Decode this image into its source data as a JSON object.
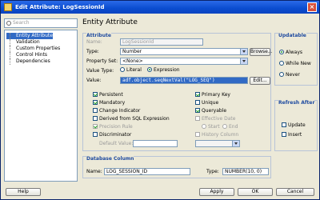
{
  "window": {
    "title": "Edit Attribute: LogSessionId",
    "close_glyph": "×"
  },
  "search": {
    "placeholder": "Search"
  },
  "nav": {
    "items": [
      {
        "label": "Entity Attribute",
        "selected": true
      },
      {
        "label": "Validation"
      },
      {
        "label": "Custom Properties"
      },
      {
        "label": "Control Hints"
      },
      {
        "label": "Dependencies"
      }
    ]
  },
  "panel": {
    "title": "Entity Attribute"
  },
  "attribute": {
    "legend": "Attribute",
    "name_label": "Name:",
    "name_value": "LogSessionId",
    "type_label": "Type:",
    "type_value": "Number",
    "browse_label": "Browse...",
    "property_set_label": "Property Set:",
    "property_set_value": "<None>",
    "value_type_label": "Value Type:",
    "value_type_literal": "Literal",
    "value_type_expression": "Expression",
    "value_label": "Value:",
    "value_value": "adf.object.seqNextVal(\"LOG_SEQ\")",
    "edit_label": "Edit...",
    "checkboxes_left": [
      {
        "label": "Persistent",
        "checked": true
      },
      {
        "label": "Mandatory",
        "checked": true
      },
      {
        "label": "Change Indicator",
        "checked": false
      },
      {
        "label": "Derived from SQL Expression",
        "checked": false
      },
      {
        "label": "Precision Rule",
        "checked": true,
        "disabled": true
      },
      {
        "label": "Discriminator",
        "checked": false
      }
    ],
    "default_value_label": "Default Value:",
    "checkboxes_right": [
      {
        "label": "Primary Key",
        "checked": true
      },
      {
        "label": "Unique",
        "checked": false
      },
      {
        "label": "Queryable",
        "checked": true
      },
      {
        "label": "Effective Date",
        "checked": false,
        "disabled": true
      },
      {
        "label": "History Column",
        "checked": false,
        "disabled": true
      }
    ],
    "start_label": "Start",
    "end_label": "End"
  },
  "updatable": {
    "legend": "Updatable",
    "options": [
      {
        "label": "Always",
        "selected": true
      },
      {
        "label": "While New",
        "selected": false
      },
      {
        "label": "Never",
        "selected": false
      }
    ]
  },
  "refresh": {
    "legend": "Refresh After",
    "options": [
      {
        "label": "Update",
        "checked": false
      },
      {
        "label": "Insert",
        "checked": false
      }
    ]
  },
  "database": {
    "legend": "Database Column",
    "name_label": "Name:",
    "name_value": "LOG_SESSION_ID",
    "type_label": "Type:",
    "type_value": "NUMBER(10, 0)"
  },
  "footer": {
    "help": "Help",
    "apply": "Apply",
    "ok": "OK",
    "cancel": "Cancel"
  }
}
